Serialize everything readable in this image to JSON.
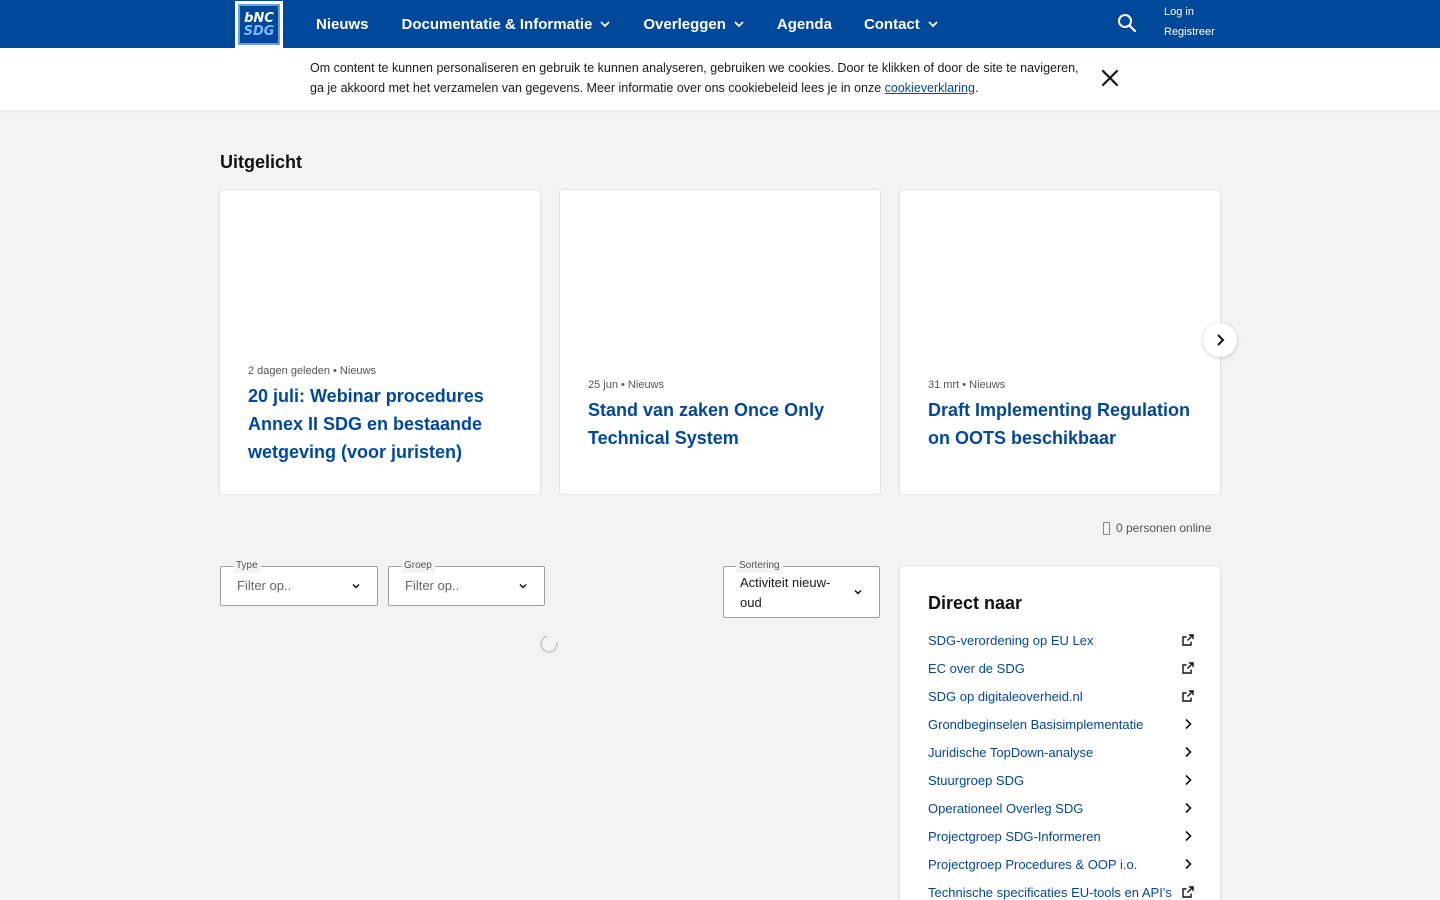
{
  "header": {
    "logo": {
      "top": "bNC",
      "bottom": "SDG"
    },
    "nav": [
      {
        "label": "Nieuws",
        "dropdown": false
      },
      {
        "label": "Documentatie & Informatie",
        "dropdown": true
      },
      {
        "label": "Overleggen",
        "dropdown": true
      },
      {
        "label": "Agenda",
        "dropdown": false
      },
      {
        "label": "Contact",
        "dropdown": true
      }
    ],
    "search_icon": "search-icon",
    "login": "Log in",
    "register": "Registreer"
  },
  "cookie": {
    "text": "Om content te kunnen personaliseren en gebruik te kunnen analyseren, gebruiken we cookies. Door te klikken of door de site te navigeren, ga je akkoord met het verzamelen van gegevens. Meer informatie over ons cookiebeleid lees je in onze ",
    "link": "cookieverklaring",
    "suffix": ".",
    "close_icon": "close-icon"
  },
  "featured": {
    "title": "Uitgelicht",
    "cards": [
      {
        "meta": "2 dagen geleden • Nieuws",
        "title": "20 juli: Webinar procedures Annex II SDG en bestaande wetgeving (voor juristen)"
      },
      {
        "meta": "25 jun • Nieuws",
        "title": "Stand van zaken Once Only Technical System"
      },
      {
        "meta": "31 mrt • Nieuws",
        "title": "Draft Implementing Regulation on OOTS beschikbaar"
      }
    ]
  },
  "online": {
    "text": "0 personen online"
  },
  "filters": {
    "type": {
      "legend": "Type",
      "placeholder": "Filter op.."
    },
    "groep": {
      "legend": "Groep",
      "placeholder": "Filter op.."
    },
    "sortering": {
      "legend": "Sortering",
      "value": "Activiteit nieuw-oud"
    }
  },
  "direct": {
    "title": "Direct naar",
    "items": [
      {
        "label": "SDG-verordening op EU Lex",
        "icon": "external-link-icon"
      },
      {
        "label": "EC over de SDG",
        "icon": "external-link-icon"
      },
      {
        "label": "SDG op digitaleoverheid.nl",
        "icon": "external-link-icon"
      },
      {
        "label": "Grondbeginselen Basisimplementatie",
        "icon": "chevron-right-icon"
      },
      {
        "label": "Juridische TopDown-analyse",
        "icon": "chevron-right-icon"
      },
      {
        "label": "Stuurgroep SDG",
        "icon": "chevron-right-icon"
      },
      {
        "label": "Operationeel Overleg SDG",
        "icon": "chevron-right-icon"
      },
      {
        "label": "Projectgroep SDG-Informeren",
        "icon": "chevron-right-icon"
      },
      {
        "label": "Projectgroep Procedures & OOP i.o.",
        "icon": "chevron-right-icon"
      },
      {
        "label": "Technische specificaties EU-tools en API's",
        "icon": "external-link-icon"
      }
    ]
  },
  "colors": {
    "brand": "#01489a",
    "background": "#f3f3f3"
  }
}
